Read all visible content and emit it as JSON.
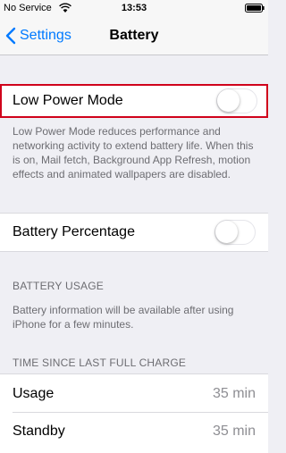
{
  "status_bar": {
    "carrier": "No Service",
    "time": "13:53"
  },
  "nav": {
    "back_label": "Settings",
    "title": "Battery"
  },
  "low_power_mode": {
    "label": "Low Power Mode",
    "enabled": false,
    "description": "Low Power Mode reduces performance and networking activity to extend battery life.  When this is on, Mail fetch, Background App Refresh, motion effects and animated wallpapers are disabled.",
    "highlight_color": "#d0021b"
  },
  "battery_percentage": {
    "label": "Battery Percentage",
    "enabled": false
  },
  "battery_usage": {
    "header": "BATTERY USAGE",
    "message": "Battery information will be available after using iPhone for a few minutes."
  },
  "time_since_charge": {
    "header": "TIME SINCE LAST FULL CHARGE",
    "rows": [
      {
        "label": "Usage",
        "value": "35 min"
      },
      {
        "label": "Standby",
        "value": "35 min"
      }
    ]
  },
  "colors": {
    "accent": "#007aff",
    "background": "#efeff4"
  }
}
